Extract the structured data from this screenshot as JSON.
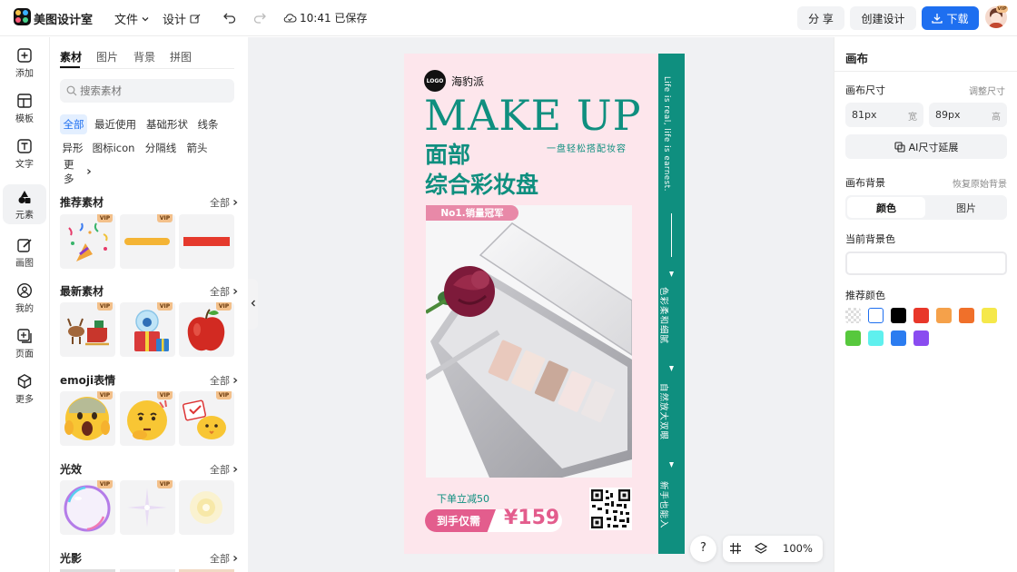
{
  "header": {
    "app_title": "美图设计室",
    "menu_file": "文件",
    "menu_design": "设计",
    "save_status": "10:41 已保存",
    "share_label": "分 享",
    "create_label": "创建设计",
    "download_label": "下载",
    "vip_badge": "VIP"
  },
  "rail": {
    "add": "添加",
    "template": "模板",
    "text": "文字",
    "element": "元素",
    "draw": "画图",
    "mine": "我的",
    "page": "页面",
    "more": "更多"
  },
  "panel": {
    "tabs": [
      "素材",
      "图片",
      "背景",
      "拼图"
    ],
    "search_placeholder": "搜索素材",
    "chips": [
      "全部",
      "最近使用",
      "基础形状",
      "线条",
      "异形",
      "图标icon",
      "分隔线",
      "箭头",
      "更多"
    ],
    "section_all": "全部",
    "vip": "VIP",
    "sections": [
      "推荐素材",
      "最新素材",
      "emoji表情",
      "光效",
      "光影"
    ]
  },
  "poster": {
    "logo_badge": "LOGO",
    "brand": "海豹派",
    "headline": "MAKE UP",
    "subtitle": "一盘轻松搭配妆容",
    "title_line1": "面部",
    "title_line2": "综合彩妆盘",
    "badge": "No1.销量冠军",
    "discount": "下单立减50",
    "price_label": "到手仅需",
    "price": "¥159",
    "side_en": "Life is real, life is earnest.",
    "side_items": [
      "色彩柔和细腻",
      "自然放大双眼",
      "新手也能入"
    ]
  },
  "right_panel": {
    "title": "画布",
    "size_label": "画布尺寸",
    "resize_link": "调整尺寸",
    "width_value": "81px",
    "width_unit": "宽",
    "height_value": "89px",
    "height_unit": "高",
    "ai_extend": "AI尺寸延展",
    "bg_label": "画布背景",
    "restore_bg": "恢复原始背景",
    "seg_color": "颜色",
    "seg_image": "图片",
    "current_bg": "当前背景色",
    "recommend": "推荐颜色",
    "swatches": [
      "#ffffff",
      "#000000",
      "#e8372a",
      "#f5a14a",
      "#f0702a",
      "#f5e84a",
      "#57c83d",
      "#5ff0ee",
      "#2b7cf0",
      "#8a4cf0"
    ]
  },
  "zoom": {
    "help": "?",
    "percent": "100%"
  }
}
